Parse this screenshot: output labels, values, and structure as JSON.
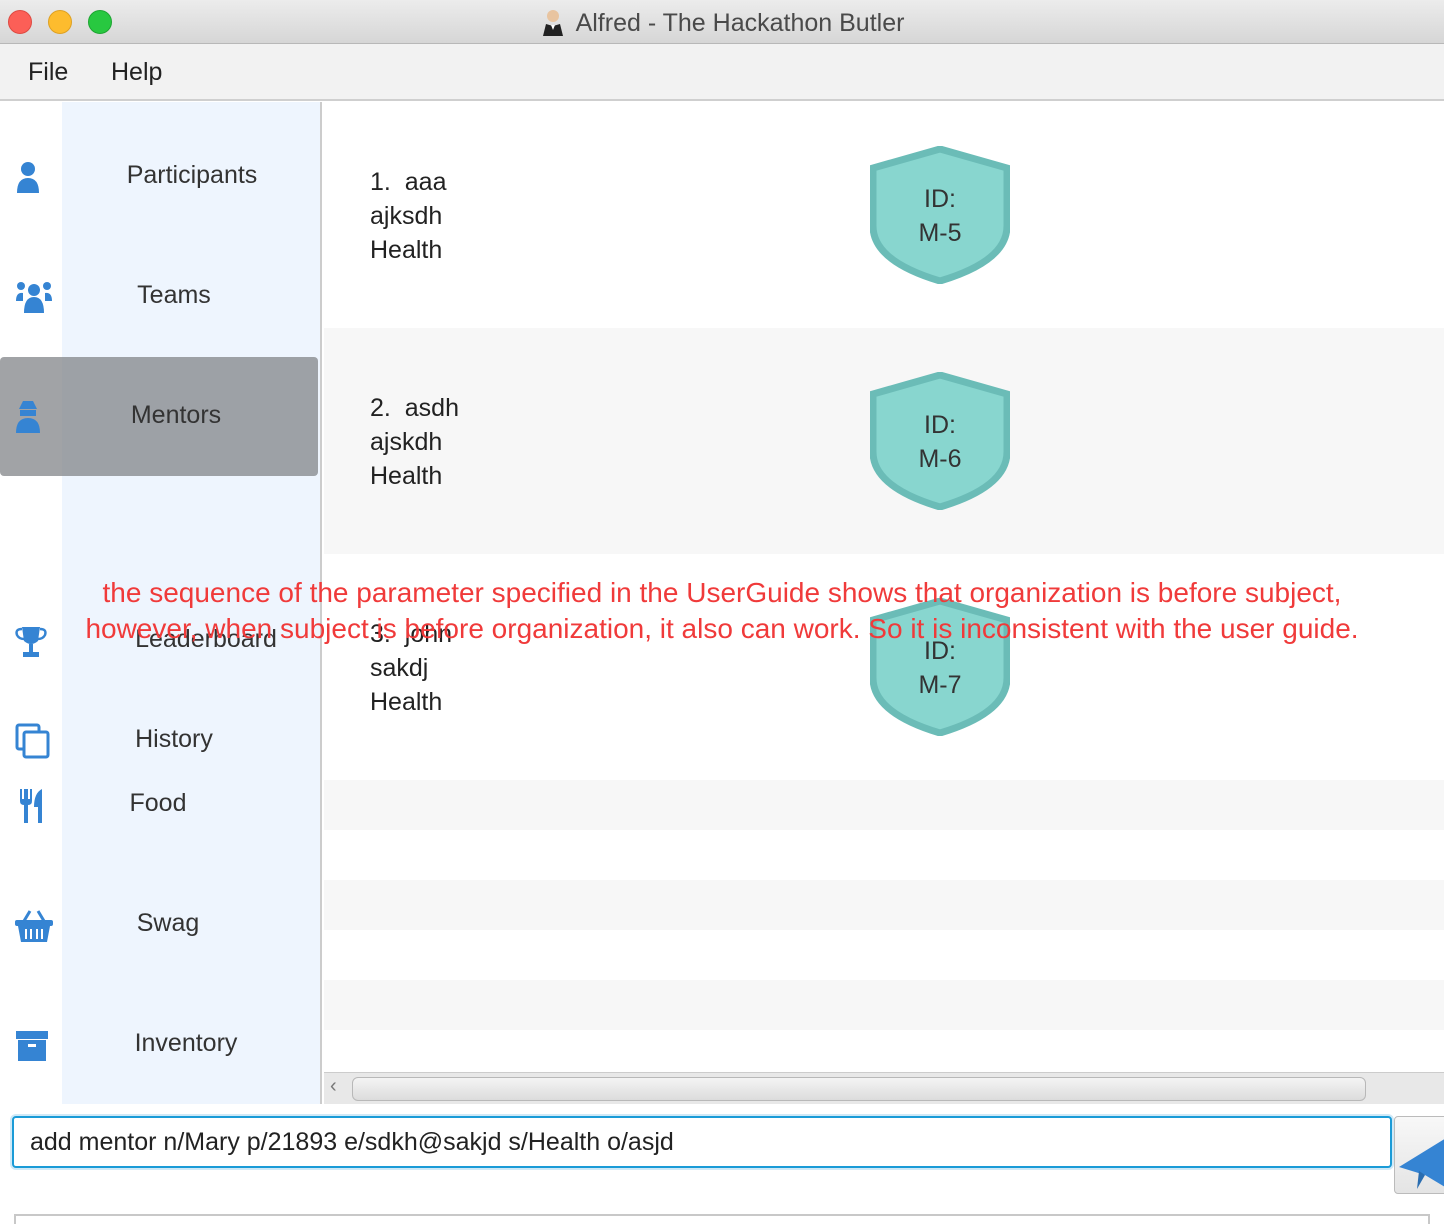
{
  "window": {
    "title": "Alfred - The Hackathon Butler"
  },
  "menu": {
    "items": [
      "File",
      "Help"
    ]
  },
  "sidebar": {
    "items": [
      {
        "label": "Participants",
        "icon": "user-icon"
      },
      {
        "label": "Teams",
        "icon": "users-icon"
      },
      {
        "label": "Mentors",
        "icon": "user-secret-icon",
        "selected": true
      },
      {
        "label": "Leaderboard",
        "icon": "trophy-icon"
      },
      {
        "label": "History",
        "icon": "copy-icon"
      },
      {
        "label": "Food",
        "icon": "utensils-icon"
      },
      {
        "label": "Swag",
        "icon": "shopping-basket-icon"
      },
      {
        "label": "Inventory",
        "icon": "archive-icon"
      }
    ]
  },
  "mentors": [
    {
      "index": "1.",
      "name": "aaa",
      "organization": "ajksdh",
      "subject": "Health",
      "id_label": "ID:",
      "id": "M-5"
    },
    {
      "index": "2.",
      "name": "asdh",
      "organization": "ajskdh",
      "subject": "Health",
      "id_label": "ID:",
      "id": "M-6"
    },
    {
      "index": "3.",
      "name": "john",
      "organization": "sakdj",
      "subject": "Health",
      "id_label": "ID:",
      "id": "M-7"
    }
  ],
  "command": {
    "value": "add mentor n/Mary p/21893 e/sdkh@sakjd s/Health o/asjd"
  },
  "annotation": {
    "lines": [
      "the sequence of the parameter specified in the UserGuide shows that organization is before subject,",
      "however, when subject is before organization, it also can work. So it is inconsistent with the user guide."
    ]
  },
  "colors": {
    "accent": "#3584d3",
    "shield": "#88d6cf",
    "shield_border": "#6bbcb7",
    "annotation": "#f03a3a"
  }
}
